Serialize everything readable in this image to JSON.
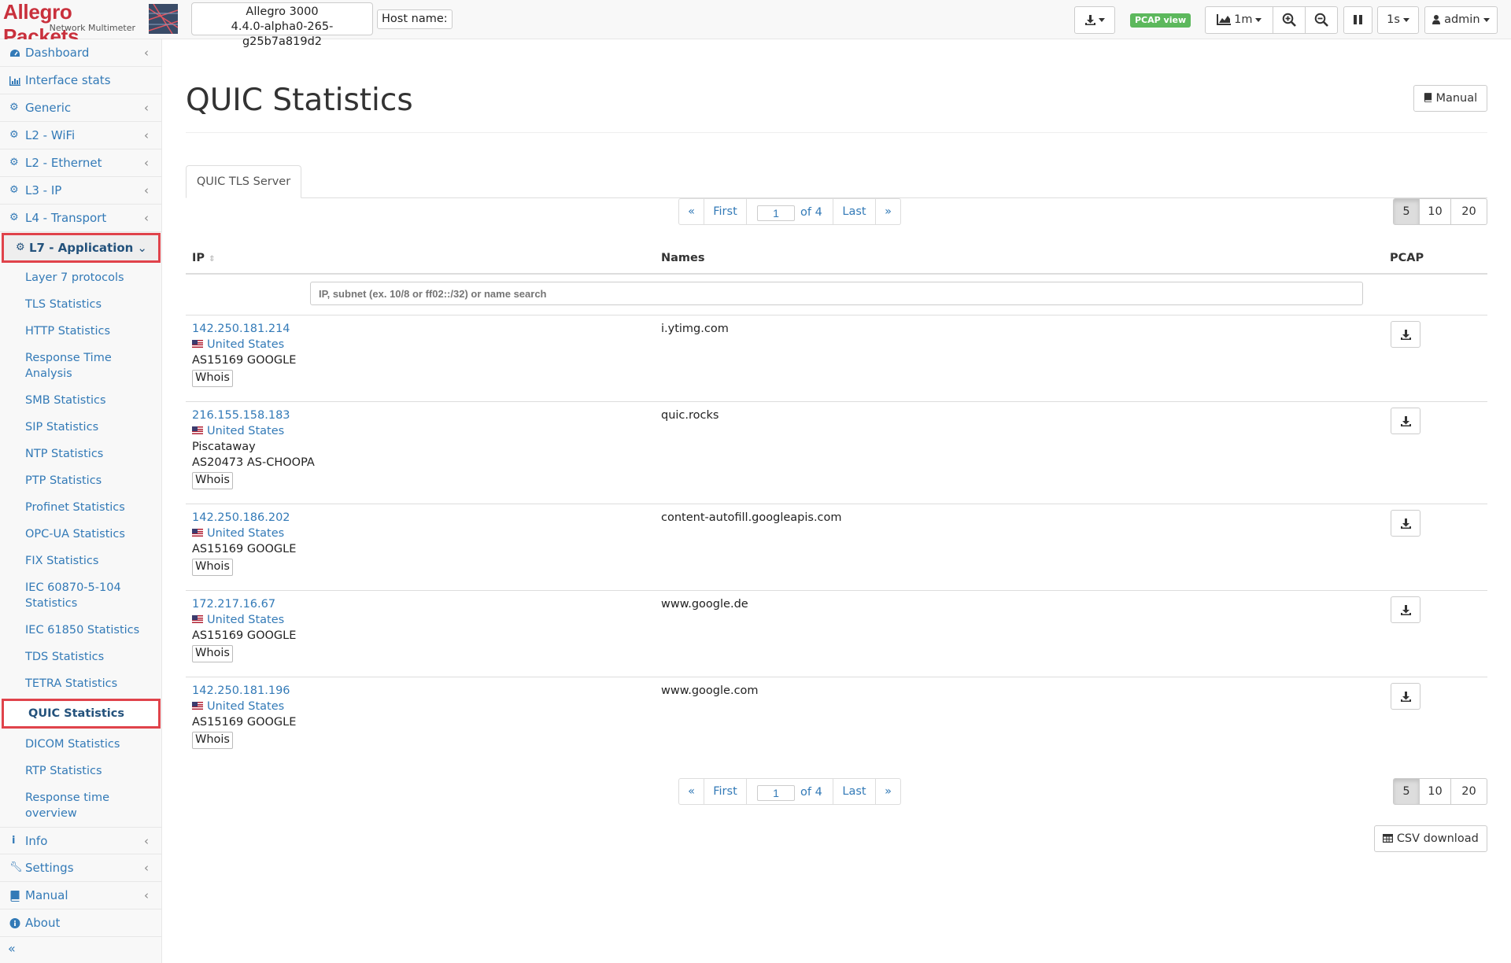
{
  "brand": {
    "name": "Allegro Packets",
    "subtitle": "Network Multimeter"
  },
  "device": {
    "model": "Allegro 3000",
    "version": "4.4.0-alpha0-265-g25b7a819d2"
  },
  "host": {
    "label": "Host name:"
  },
  "toolbar": {
    "pcap_badge": "PCAP view",
    "graph_range": "1m",
    "refresh_interval": "1s",
    "user": "admin"
  },
  "sidebar": {
    "items": [
      {
        "label": "Dashboard",
        "icon": "dashboard-icon"
      },
      {
        "label": "Interface stats",
        "icon": "bar-chart-icon"
      },
      {
        "label": "Generic",
        "icon": "gear-icon"
      },
      {
        "label": "L2 - WiFi",
        "icon": "gear-icon"
      },
      {
        "label": "L2 - Ethernet",
        "icon": "gear-icon"
      },
      {
        "label": "L3 - IP",
        "icon": "gear-icon"
      },
      {
        "label": "L4 - Transport",
        "icon": "gear-icon"
      },
      {
        "label": "L7 - Application",
        "icon": "gear-icon"
      }
    ],
    "subitems": [
      "Layer 7 protocols",
      "TLS Statistics",
      "HTTP Statistics",
      "Response Time Analysis",
      "SMB Statistics",
      "SIP Statistics",
      "NTP Statistics",
      "PTP Statistics",
      "Profinet Statistics",
      "OPC-UA Statistics",
      "FIX Statistics",
      "IEC 60870-5-104 Statistics",
      "IEC 61850 Statistics",
      "TDS Statistics",
      "TETRA Statistics",
      "QUIC Statistics",
      "DICOM Statistics",
      "RTP Statistics",
      "Response time overview"
    ],
    "bottom_items": [
      {
        "label": "Info",
        "icon": "info-icon"
      },
      {
        "label": "Settings",
        "icon": "wrench-icon"
      },
      {
        "label": "Manual",
        "icon": "book-icon"
      },
      {
        "label": "About",
        "icon": "info-circle-icon"
      }
    ],
    "collapse": "«"
  },
  "page": {
    "title": "QUIC Statistics",
    "manual_button": "Manual"
  },
  "tabs": [
    "QUIC TLS Server"
  ],
  "pagination": {
    "prev": "«",
    "first": "First",
    "current": "1",
    "of": "of 4",
    "last": "Last",
    "next": "»",
    "sizes": [
      "5",
      "10",
      "20"
    ],
    "selected_size": "5"
  },
  "table": {
    "headers": {
      "ip": "IP",
      "names": "Names",
      "pcap": "PCAP"
    },
    "search_placeholder": "IP, subnet (ex. 10/8 or ff02::/32) or name search",
    "rows": [
      {
        "ip": "142.250.181.214",
        "country": "United States",
        "city": "",
        "as": "AS15169 GOOGLE",
        "whois": "Whois",
        "names": "i.ytimg.com"
      },
      {
        "ip": "216.155.158.183",
        "country": "United States",
        "city": "Piscataway",
        "as": "AS20473 AS-CHOOPA",
        "whois": "Whois",
        "names": "quic.rocks"
      },
      {
        "ip": "142.250.186.202",
        "country": "United States",
        "city": "",
        "as": "AS15169 GOOGLE",
        "whois": "Whois",
        "names": "content-autofill.googleapis.com"
      },
      {
        "ip": "172.217.16.67",
        "country": "United States",
        "city": "",
        "as": "AS15169 GOOGLE",
        "whois": "Whois",
        "names": "www.google.de"
      },
      {
        "ip": "142.250.181.196",
        "country": "United States",
        "city": "",
        "as": "AS15169 GOOGLE",
        "whois": "Whois",
        "names": "www.google.com"
      }
    ]
  },
  "csv_button": "CSV download",
  "colors": {
    "brand": "#c9303c",
    "link": "#337ab7",
    "highlight": "#e0434b",
    "badge": "#5cb85c"
  }
}
